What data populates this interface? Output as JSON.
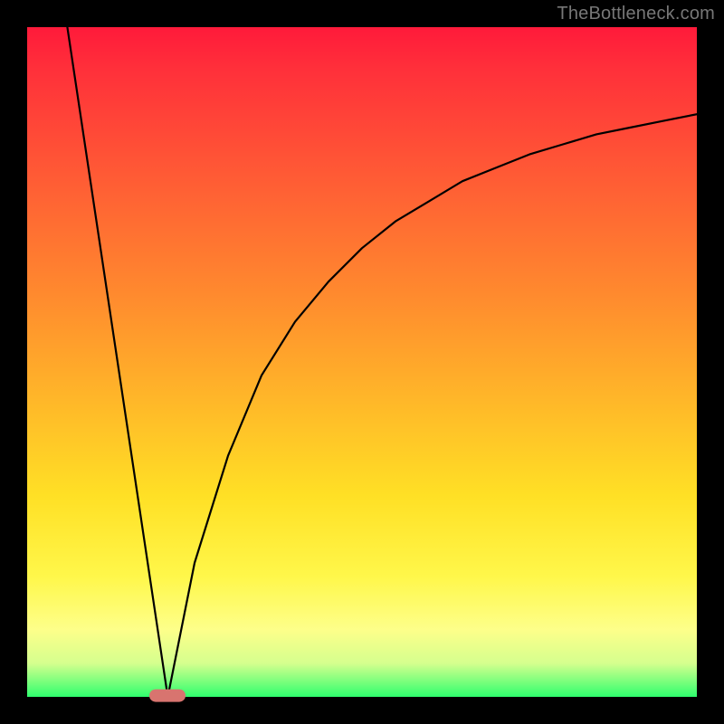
{
  "watermark": "TheBottleneck.com",
  "colors": {
    "frame": "#000000",
    "curve": "#000000",
    "marker": "#d8746f",
    "gradient_top": "#ff1a3a",
    "gradient_bottom": "#2fff6e"
  },
  "chart_data": {
    "type": "line",
    "title": "",
    "xlabel": "",
    "ylabel": "",
    "xlim": [
      0,
      100
    ],
    "ylim": [
      0,
      100
    ],
    "grid": false,
    "legend": false,
    "annotations": [
      {
        "type": "marker",
        "x": 21,
        "y": 0,
        "shape": "pill",
        "color": "#d8746f"
      }
    ],
    "series": [
      {
        "name": "left-descent",
        "segment": "linear",
        "x": [
          6,
          21
        ],
        "y": [
          100,
          0
        ]
      },
      {
        "name": "right-ascent",
        "segment": "log-like",
        "x": [
          21,
          25,
          30,
          35,
          40,
          45,
          50,
          55,
          60,
          65,
          70,
          75,
          80,
          85,
          90,
          95,
          100
        ],
        "y": [
          0,
          20,
          36,
          48,
          56,
          62,
          67,
          71,
          74,
          77,
          79,
          81,
          82.5,
          84,
          85,
          86,
          87
        ]
      }
    ],
    "background": {
      "type": "vertical-gradient",
      "stops": [
        {
          "pos": 0.0,
          "color": "#ff1a3a"
        },
        {
          "pos": 0.06,
          "color": "#ff2f3a"
        },
        {
          "pos": 0.22,
          "color": "#ff5a35"
        },
        {
          "pos": 0.4,
          "color": "#ff8a2e"
        },
        {
          "pos": 0.55,
          "color": "#ffb529"
        },
        {
          "pos": 0.7,
          "color": "#ffe025"
        },
        {
          "pos": 0.82,
          "color": "#fff74a"
        },
        {
          "pos": 0.9,
          "color": "#fdff8a"
        },
        {
          "pos": 0.95,
          "color": "#d5ff8e"
        },
        {
          "pos": 1.0,
          "color": "#2fff6e"
        }
      ]
    }
  }
}
